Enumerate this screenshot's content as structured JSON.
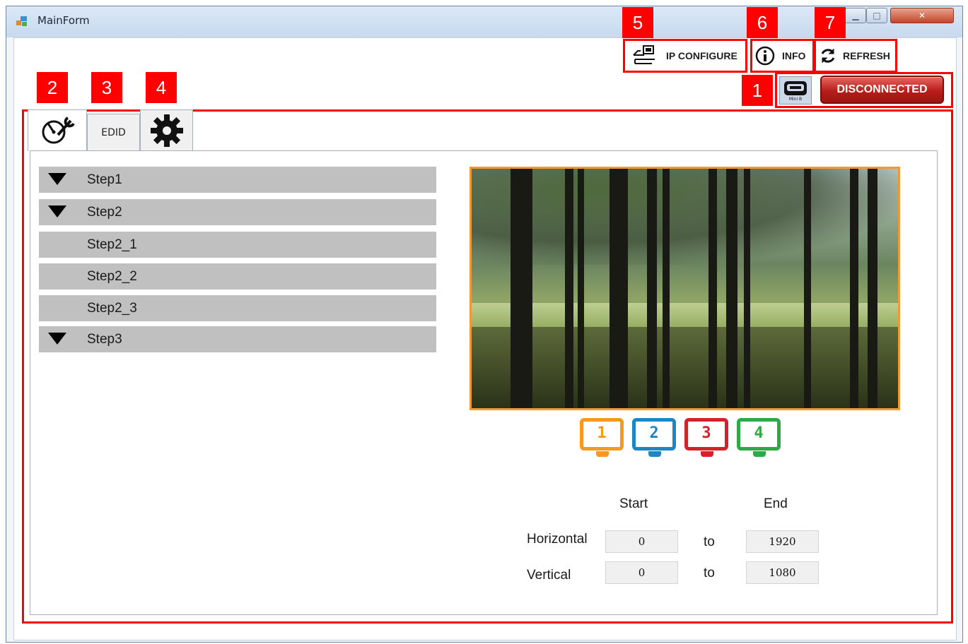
{
  "window": {
    "title": "MainForm"
  },
  "toolbar": {
    "ip_configure": "IP CONFIGURE",
    "info": "INFO",
    "refresh": "REFRESH",
    "connection_status": "DISCONNECTED",
    "usb_label": "Mini B"
  },
  "markers": [
    "1",
    "2",
    "3",
    "4",
    "5",
    "6",
    "7"
  ],
  "tabs": [
    {
      "name": "wrench-tab",
      "icon": "gauge-wrench-icon",
      "active": true
    },
    {
      "name": "edid-tab",
      "label": "EDID",
      "active": false
    },
    {
      "name": "settings-tab",
      "icon": "gear-icon",
      "active": false
    }
  ],
  "steps": [
    {
      "label": "Step1",
      "expandable": true
    },
    {
      "label": "Step2",
      "expandable": true
    },
    {
      "label": "Step2_1",
      "expandable": false
    },
    {
      "label": "Step2_2",
      "expandable": false
    },
    {
      "label": "Step2_3",
      "expandable": false
    },
    {
      "label": "Step3",
      "expandable": true
    }
  ],
  "preview": {
    "image": "forest-photo",
    "border_color": "#f19a33"
  },
  "monitors": [
    {
      "label": "1",
      "color": "#f39a1f"
    },
    {
      "label": "2",
      "color": "#1f86c4"
    },
    {
      "label": "3",
      "color": "#d2222a"
    },
    {
      "label": "4",
      "color": "#2fa846"
    }
  ],
  "range": {
    "start_label": "Start",
    "end_label": "End",
    "to_label": "to",
    "horizontal": {
      "label": "Horizontal",
      "start": "0",
      "end": "1920"
    },
    "vertical": {
      "label": "Vertical",
      "start": "0",
      "end": "1080"
    }
  },
  "colors": {
    "highlight": "#ff0000",
    "disconnected": "#b81e1a"
  }
}
